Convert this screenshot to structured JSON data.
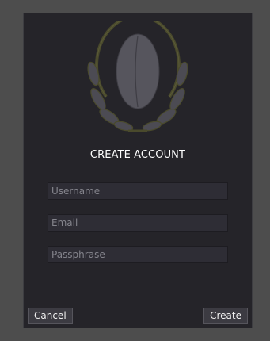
{
  "dialog": {
    "title": "CREATE ACCOUNT",
    "logo_icon": "laurel-emblem-icon",
    "fields": {
      "username_placeholder": "Username",
      "email_placeholder": "Email",
      "passphrase_placeholder": "Passphrase"
    },
    "buttons": {
      "cancel_label": "Cancel",
      "create_label": "Create"
    }
  },
  "colors": {
    "background": "#4d4d4d",
    "panel": "#252429",
    "field": "#2e2d35",
    "emblem_ring": "#4a4a2c",
    "emblem_fill": "#56555d"
  }
}
